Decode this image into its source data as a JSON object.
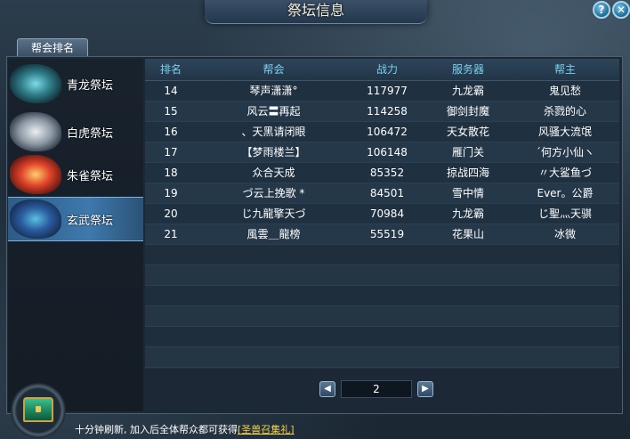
{
  "window": {
    "title": "祭坛信息"
  },
  "buttons": {
    "help": "?",
    "close": "✕"
  },
  "tab": {
    "label": "帮会排名"
  },
  "sidebar": {
    "items": [
      {
        "label": "青龙祭坛",
        "icon": "azure-dragon-emblem",
        "selected": false
      },
      {
        "label": "白虎祭坛",
        "icon": "white-tiger-emblem",
        "selected": false
      },
      {
        "label": "朱雀祭坛",
        "icon": "vermilion-bird-emblem",
        "selected": false
      },
      {
        "label": "玄武祭坛",
        "icon": "black-tortoise-emblem",
        "selected": true
      }
    ]
  },
  "table": {
    "headers": [
      "排名",
      "帮会",
      "战力",
      "服务器",
      "帮主"
    ],
    "rows": [
      [
        "14",
        "琴声潇潇°",
        "117977",
        "九龙霸",
        "鬼见愁"
      ],
      [
        "15",
        "风云〓再起",
        "114258",
        "御剑封魔",
        "杀戮的心"
      ],
      [
        "16",
        "、天黑请闭眼",
        "106472",
        "天女散花",
        "风骚大流氓"
      ],
      [
        "17",
        "【梦雨楼兰】",
        "106148",
        "雁门关",
        "ˊ何方小仙ヽ"
      ],
      [
        "18",
        "众合天成",
        "85352",
        "掠战四海",
        "〃大鲨鱼づ"
      ],
      [
        "19",
        "づ云上挽歌 *",
        "84501",
        "雪中情",
        "Ever。公爵"
      ],
      [
        "20",
        "じ九龍擎天づ",
        "70984",
        "九龙霸",
        "じ聖灬天骐"
      ],
      [
        "21",
        "風雲＿龍榜",
        "55519",
        "花果山",
        "冰微"
      ]
    ]
  },
  "pager": {
    "page": "2",
    "prev_icon": "◀",
    "next_icon": "▶"
  },
  "footer": {
    "notice": "十分钟刷新, 加入后全体帮众都可获得",
    "reward_link": "[圣兽召集礼]",
    "chest_icon": "treasure-chest-icon"
  },
  "colors": {
    "header_text": "#7dd0f0",
    "selected_tab": "#3e79ad",
    "reward_link": "#f3d04a"
  }
}
